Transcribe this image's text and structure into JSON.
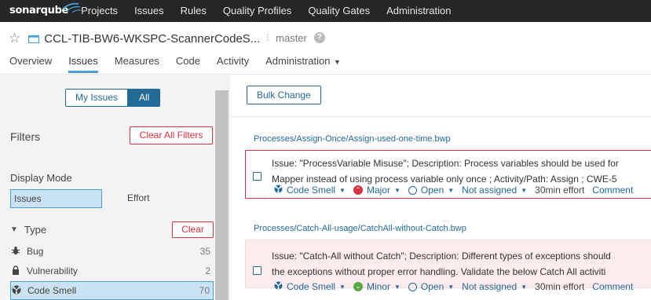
{
  "topbar": {
    "logo": "sonarqube",
    "nav": [
      "Projects",
      "Issues",
      "Rules",
      "Quality Profiles",
      "Quality Gates",
      "Administration"
    ]
  },
  "component": {
    "name": "CCL-TIB-BW6-WKSPC-ScannerCodeS...",
    "branch": "master",
    "tabs": [
      "Overview",
      "Issues",
      "Measures",
      "Code",
      "Activity",
      "Administration"
    ],
    "active_tab": "Issues"
  },
  "sidebar": {
    "toggle": {
      "my_issues": "My Issues",
      "all": "All"
    },
    "filters_title": "Filters",
    "clear_all": "Clear All Filters",
    "display_mode": {
      "title": "Display Mode",
      "issues": "Issues",
      "effort": "Effort"
    },
    "type": {
      "title": "Type",
      "clear": "Clear",
      "items": [
        {
          "label": "Bug",
          "count": "35",
          "icon": "bug-icon"
        },
        {
          "label": "Vulnerability",
          "count": "2",
          "icon": "lock-icon"
        },
        {
          "label": "Code Smell",
          "count": "70",
          "icon": "code-smell-icon",
          "selected": true
        }
      ]
    }
  },
  "main": {
    "bulk_change": "Bulk Change",
    "groups": [
      {
        "path": "Processes/Assign-Once/Assign-used-one-time.bwp",
        "line1": "Issue: \"ProcessVariable Misuse\"; Description: Process variables should be used for",
        "line2": "Mapper instead of using process variable only once ; Activity/Path: Assign ; CWE-5",
        "type": "Code Smell",
        "severity": "Major",
        "status": "Open",
        "assignee": "Not assigned",
        "effort": "30min effort",
        "comment": "Comment"
      },
      {
        "path": "Processes/Catch-All-usage/CatchAll-without-Catch.bwp",
        "line1": "Issue: \"Catch-All without Catch\"; Description: Different types of exceptions should",
        "line2": "the exceptions without proper error handling. Validate the below Catch All activiti",
        "type": "Code Smell",
        "severity": "Minor",
        "status": "Open",
        "assignee": "Not assigned",
        "effort": "30min effort",
        "comment": "Comment"
      }
    ]
  },
  "colors": {
    "topbar": "#262626",
    "accent": "#236a97",
    "selected_bg": "#cae3f2",
    "error": "#d4333f",
    "minor": "#5ba745"
  }
}
